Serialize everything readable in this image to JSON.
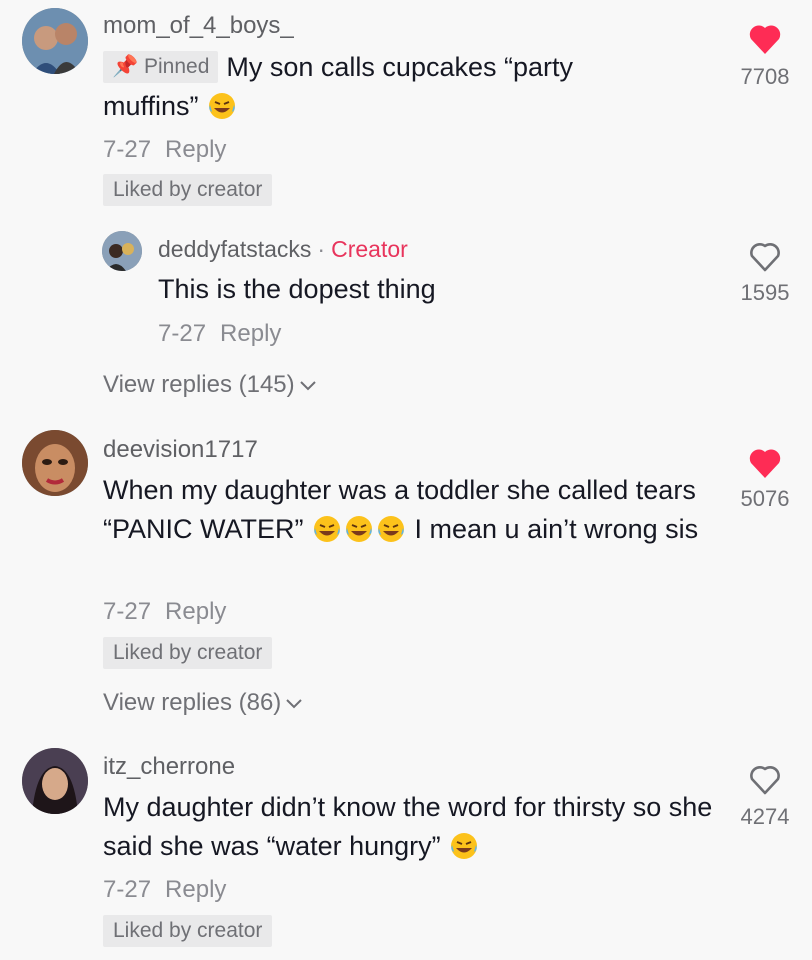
{
  "comments": [
    {
      "username": "mom_of_4_boys_",
      "pinned_label": "Pinned",
      "text": "My son calls cupcakes “party muffins”",
      "emoji": [
        "face-with-tears-of-joy"
      ],
      "date": "7-27",
      "reply_label": "Reply",
      "liked_by_creator": "Liked by creator",
      "like_count": "7708",
      "liked": true
    },
    {
      "username": "deevision1717",
      "text_part1": "When my daughter was a toddler she called tears “PANIC WATER”",
      "text_part2": "I mean u ain’t wrong sis",
      "emoji": [
        "face-with-tears-of-joy",
        "face-with-tears-of-joy",
        "face-with-tears-of-joy"
      ],
      "date": "7-27",
      "reply_label": "Reply",
      "liked_by_creator": "Liked by creator",
      "view_replies": "View replies (86)",
      "like_count": "5076",
      "liked": true
    },
    {
      "username": "itz_cherrone",
      "text": "My daughter didn’t know the word for thirsty so she said she was “water hungry”",
      "emoji": [
        "face-with-tears-of-joy"
      ],
      "date": "7-27",
      "reply_label": "Reply",
      "liked_by_creator": "Liked by creator",
      "like_count": "4274",
      "liked": false
    }
  ],
  "reply": {
    "username": "deddyfatstacks",
    "separator": "·",
    "creator_label": "Creator",
    "text": "This is the dopest thing",
    "date": "7-27",
    "reply_label": "Reply",
    "like_count": "1595",
    "liked": false
  },
  "first_view_replies": "View replies (145)",
  "colors": {
    "liked_heart": "#fe2c55",
    "creator_accent": "#e8345c",
    "muted_text": "#8a8b91",
    "background": "#f8f8f8"
  }
}
